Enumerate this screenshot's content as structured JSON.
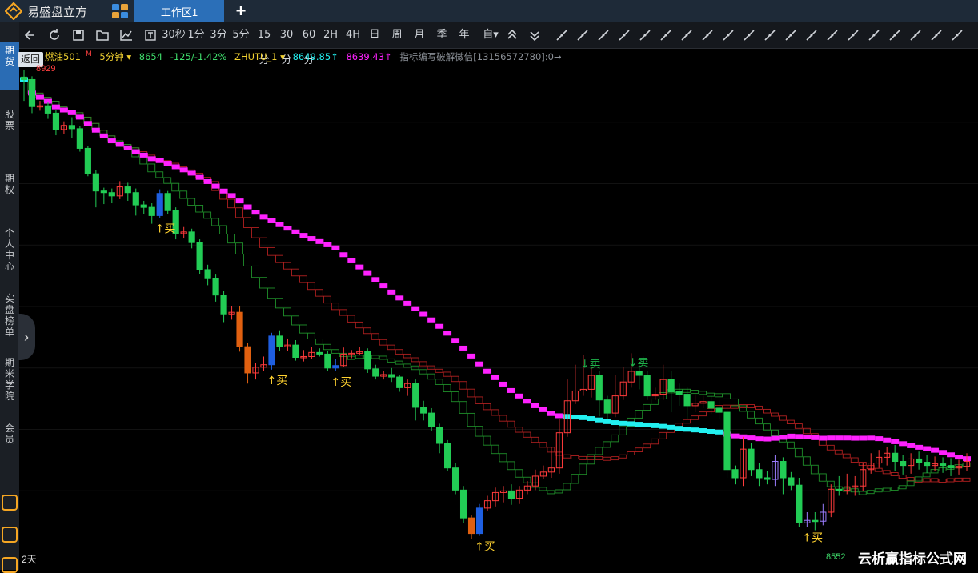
{
  "titlebar": {
    "app_name": "易盛盘立方",
    "workspace_tab": "工作区1",
    "add_tab": "+"
  },
  "toolbar": {
    "items": [
      "30秒",
      "1分",
      "3分",
      "5分",
      "15分",
      "30分",
      "60分",
      "2H",
      "4H",
      "日",
      "周",
      "月",
      "季",
      "年",
      "自▾"
    ]
  },
  "sidebar": {
    "items": [
      "期货",
      "股票",
      "期权",
      "个人中心",
      "实盘榜单",
      "期米学院",
      "会员"
    ]
  },
  "chart_header": {
    "back_label": "返回",
    "symbol": "燃油501",
    "symbol_mark": "M",
    "period": "5分钟 ▾",
    "last_price": "8654",
    "change": "-125/-1.42%",
    "indicator": "ZHUTU_1 ▾",
    "value1": "8649.85↑",
    "value2": "8639.43↑",
    "note": "指标编写破解微信[13156572780]:0→"
  },
  "chart_labels": {
    "high_price": "8929",
    "low_price": "8552",
    "days": "2天",
    "buy": "↑买",
    "sell": "↓卖"
  },
  "watermark": "云析赢指标公式网",
  "colors": {
    "up": "#ff3b3b",
    "down": "#22cc55",
    "cyan": "#22f0f0",
    "magenta": "#ff22ff",
    "blue": "#1f5fe0",
    "orange": "#e06010",
    "purple": "#9b7dff",
    "buy_text": "#ffd230"
  },
  "chart_data": {
    "type": "candlestick",
    "interval": "5分钟",
    "candles": [
      [
        8929,
        8926,
        8938,
        8900
      ],
      [
        8926,
        8893,
        8930,
        8885
      ],
      [
        8893,
        8894,
        8900,
        8888
      ],
      [
        8894,
        8885,
        8899,
        8878
      ],
      [
        8885,
        8865,
        8889,
        8858
      ],
      [
        8865,
        8870,
        8875,
        8860
      ],
      [
        8870,
        8866,
        8880,
        8855
      ],
      [
        8866,
        8842,
        8869,
        8838
      ],
      [
        8842,
        8811,
        8845,
        8808
      ],
      [
        8811,
        8790,
        8816,
        8770
      ],
      [
        8790,
        8788,
        8794,
        8774
      ],
      [
        8788,
        8784,
        8793,
        8775
      ],
      [
        8784,
        8795,
        8802,
        8780
      ],
      [
        8795,
        8788,
        8800,
        8778
      ],
      [
        8788,
        8773,
        8793,
        8760
      ],
      [
        8773,
        8770,
        8778,
        8762
      ],
      [
        8770,
        8760,
        8775,
        8750
      ],
      [
        8760,
        8787,
        8792,
        8757
      ],
      [
        8787,
        8766,
        8790,
        8762
      ],
      [
        8766,
        8738,
        8770,
        8731
      ],
      [
        8738,
        8740,
        8746,
        8732
      ],
      [
        8740,
        8727,
        8744,
        8720
      ],
      [
        8727,
        8694,
        8731,
        8689
      ],
      [
        8694,
        8683,
        8700,
        8675
      ],
      [
        8683,
        8663,
        8688,
        8655
      ],
      [
        8663,
        8640,
        8668,
        8630
      ],
      [
        8640,
        8642,
        8650,
        8633
      ],
      [
        8642,
        8600,
        8650,
        8594
      ],
      [
        8600,
        8568,
        8605,
        8555
      ],
      [
        8568,
        8575,
        8580,
        8560
      ],
      [
        8575,
        8578,
        8588,
        8570
      ],
      [
        8578,
        8613,
        8617,
        8572
      ],
      [
        8613,
        8600,
        8620,
        8595
      ],
      [
        8600,
        8602,
        8610,
        8595
      ],
      [
        8602,
        8587,
        8608,
        8583
      ],
      [
        8587,
        8588,
        8596,
        8582
      ],
      [
        8588,
        8593,
        8600,
        8585
      ],
      [
        8593,
        8591,
        8598,
        8588
      ],
      [
        8591,
        8574,
        8595,
        8570
      ],
      [
        8574,
        8577,
        8585,
        8570
      ],
      [
        8577,
        8591,
        8599,
        8575
      ],
      [
        8591,
        8592,
        8596,
        8586
      ],
      [
        8592,
        8594,
        8600,
        8590
      ],
      [
        8594,
        8573,
        8598,
        8568
      ],
      [
        8573,
        8564,
        8578,
        8560
      ],
      [
        8564,
        8566,
        8570,
        8560
      ],
      [
        8566,
        8563,
        8574,
        8557
      ],
      [
        8563,
        8550,
        8566,
        8545
      ],
      [
        8550,
        8555,
        8560,
        8540
      ],
      [
        8555,
        8526,
        8560,
        8510
      ],
      [
        8526,
        8519,
        8534,
        8510
      ],
      [
        8519,
        8502,
        8525,
        8497
      ],
      [
        8502,
        8482,
        8506,
        8470
      ],
      [
        8482,
        8452,
        8486,
        8448
      ],
      [
        8452,
        8425,
        8458,
        8420
      ],
      [
        8425,
        8391,
        8430,
        8385
      ],
      [
        8391,
        8372,
        8394,
        8365
      ],
      [
        8372,
        8403,
        8408,
        8369
      ],
      [
        8403,
        8412,
        8418,
        8400
      ],
      [
        8412,
        8422,
        8428,
        8405
      ],
      [
        8422,
        8424,
        8430,
        8410
      ],
      [
        8424,
        8415,
        8432,
        8407
      ],
      [
        8415,
        8425,
        8430,
        8408
      ],
      [
        8425,
        8430,
        8436,
        8420
      ],
      [
        8430,
        8442,
        8450,
        8425
      ],
      [
        8442,
        8447,
        8455,
        8438
      ],
      [
        8447,
        8452,
        8478,
        8440
      ],
      [
        8452,
        8495,
        8512,
        8445
      ],
      [
        8495,
        8534,
        8560,
        8490
      ],
      [
        8534,
        8546,
        8578,
        8530
      ],
      [
        8546,
        8548,
        8590,
        8540
      ],
      [
        8548,
        8565,
        8575,
        8538
      ],
      [
        8565,
        8535,
        8570,
        8515
      ],
      [
        8535,
        8519,
        8540,
        8512
      ],
      [
        8519,
        8540,
        8565,
        8514
      ],
      [
        8540,
        8557,
        8575,
        8535
      ],
      [
        8557,
        8570,
        8592,
        8550
      ],
      [
        8570,
        8565,
        8578,
        8548
      ],
      [
        8565,
        8540,
        8570,
        8535
      ],
      [
        8540,
        8542,
        8550,
        8535
      ],
      [
        8542,
        8560,
        8578,
        8535
      ],
      [
        8560,
        8545,
        8570,
        8520
      ],
      [
        8545,
        8542,
        8555,
        8528
      ],
      [
        8542,
        8528,
        8550,
        8512
      ],
      [
        8528,
        8531,
        8542,
        8520
      ],
      [
        8531,
        8533,
        8540,
        8525
      ],
      [
        8533,
        8525,
        8540,
        8518
      ],
      [
        8525,
        8520,
        8535,
        8512
      ],
      [
        8520,
        8450,
        8528,
        8440
      ],
      [
        8450,
        8440,
        8455,
        8432
      ],
      [
        8440,
        8475,
        8490,
        8430
      ],
      [
        8475,
        8450,
        8482,
        8442
      ],
      [
        8450,
        8440,
        8458,
        8430
      ],
      [
        8440,
        8438,
        8448,
        8432
      ],
      [
        8438,
        8460,
        8468,
        8430
      ],
      [
        8460,
        8440,
        8465,
        8420
      ],
      [
        8440,
        8431,
        8447,
        8425
      ],
      [
        8431,
        8385,
        8440,
        8380
      ],
      [
        8385,
        8388,
        8398,
        8380
      ],
      [
        8388,
        8387,
        8398,
        8376
      ],
      [
        8387,
        8398,
        8408,
        8382
      ],
      [
        8398,
        8426,
        8432,
        8392
      ],
      [
        8426,
        8425,
        8442,
        8418
      ],
      [
        8425,
        8429,
        8445,
        8420
      ],
      [
        8429,
        8430,
        8442,
        8418
      ],
      [
        8430,
        8450,
        8458,
        8424
      ],
      [
        8450,
        8458,
        8470,
        8445
      ],
      [
        8458,
        8465,
        8474,
        8452
      ],
      [
        8465,
        8470,
        8478,
        8455
      ],
      [
        8470,
        8460,
        8480,
        8448
      ],
      [
        8460,
        8455,
        8468,
        8444
      ],
      [
        8455,
        8463,
        8470,
        8445
      ],
      [
        8463,
        8459,
        8472,
        8450
      ],
      [
        8459,
        8455,
        8468,
        8446
      ],
      [
        8455,
        8457,
        8466,
        8448
      ],
      [
        8457,
        8455,
        8465,
        8446
      ],
      [
        8455,
        8452,
        8464,
        8442
      ],
      [
        8452,
        8454,
        8462,
        8444
      ],
      [
        8454,
        8460,
        8470,
        8448
      ]
    ]
  }
}
